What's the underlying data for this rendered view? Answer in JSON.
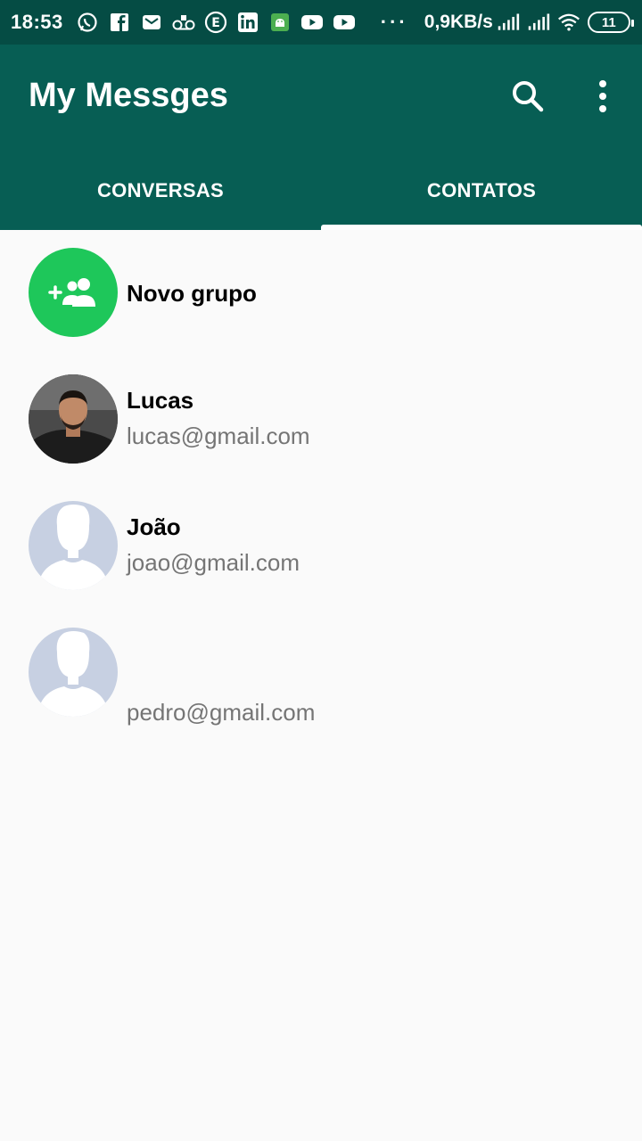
{
  "status_bar": {
    "time": "18:53",
    "notification_icons": [
      "whatsapp-icon",
      "facebook-icon",
      "mail-icon",
      "voicemail-icon",
      "e-icon",
      "linkedin-icon",
      "android-icon",
      "youtube-icon",
      "youtube-icon"
    ],
    "overflow": "···",
    "speed": "0,9KB/s",
    "battery": "11"
  },
  "app_bar": {
    "title": "My Messges",
    "background": "#075e54"
  },
  "tabs": [
    {
      "label": "CONVERSAS",
      "active": false
    },
    {
      "label": "CONTATOS",
      "active": true
    }
  ],
  "contacts": [
    {
      "name": "Novo grupo",
      "email": "",
      "avatar": "group-add-icon",
      "avatar_color": "#1ec75a"
    },
    {
      "name": "Lucas",
      "email": "lucas@gmail.com",
      "avatar": "user-photo"
    },
    {
      "name": "João",
      "email": "joao@gmail.com",
      "avatar": "default-person-icon"
    },
    {
      "name": "",
      "email": "pedro@gmail.com",
      "avatar": "default-person-icon"
    }
  ]
}
